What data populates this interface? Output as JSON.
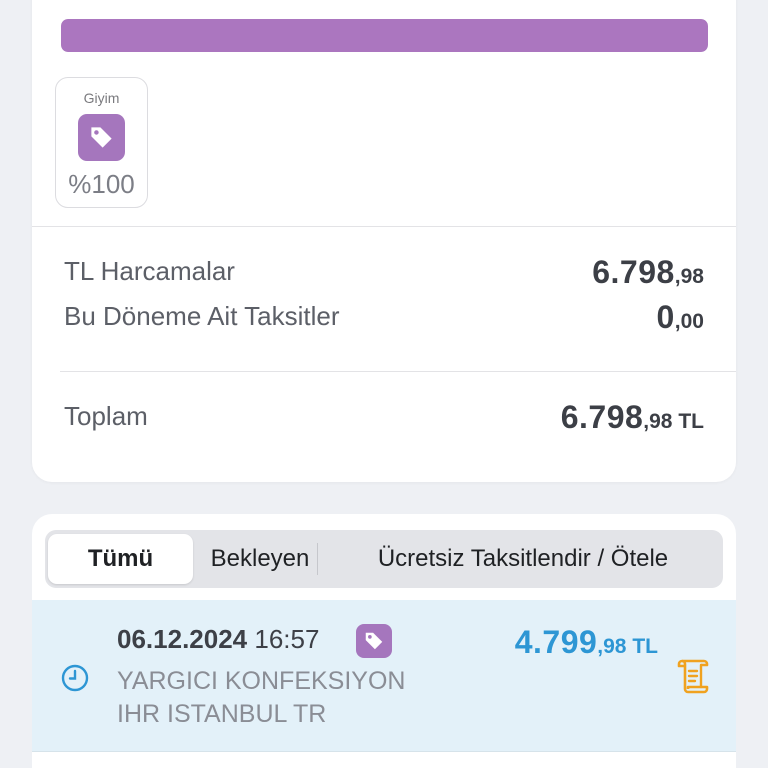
{
  "summary": {
    "progress_percent": 100,
    "progress_color": "#ab76bf",
    "category": {
      "label": "Giyim",
      "icon": "tag-icon",
      "percent_text": "%100",
      "color": "#a576bd"
    },
    "rows": [
      {
        "label": "TL Harcamalar",
        "value_main": "6.798",
        "value_decimal": ",98",
        "currency": ""
      },
      {
        "label": "Bu Döneme Ait Taksitler",
        "value_main": "0",
        "value_decimal": ",00",
        "currency": ""
      }
    ],
    "total": {
      "label": "Toplam",
      "value_main": "6.798",
      "value_decimal": ",98",
      "currency": "TL"
    }
  },
  "tabs": [
    {
      "label": "Tümü",
      "active": true
    },
    {
      "label": "Bekleyen",
      "active": false
    },
    {
      "label": "Ücretsiz Taksitlendir / Ötele",
      "active": false
    }
  ],
  "transactions": [
    {
      "date": "06.12.2024",
      "time": "16:57",
      "status_icon": "clock-icon",
      "category_icon": "tag-icon",
      "merchant_line1": "YARGICI KONFEKSIYON",
      "merchant_line2": "IHR ISTANBUL TR",
      "amount_main": "4.799",
      "amount_decimal": ",98",
      "currency": "TL",
      "action_icon": "receipt-icon",
      "amount_color": "#2d96d4"
    }
  ]
}
